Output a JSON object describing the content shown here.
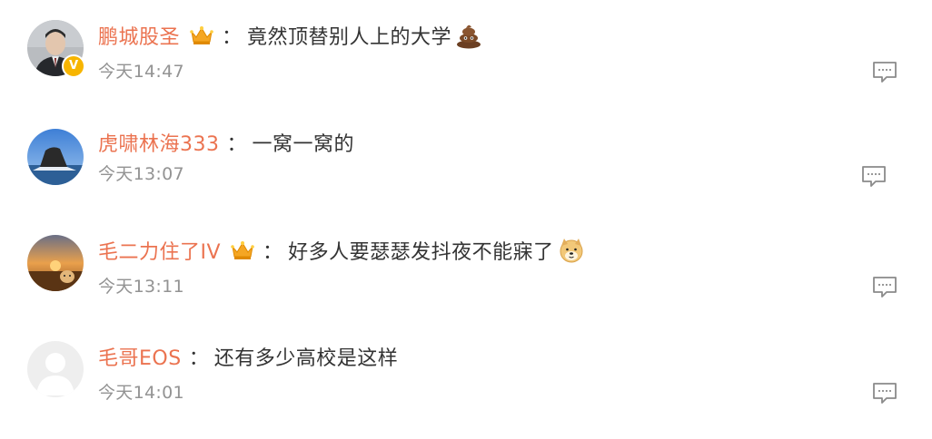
{
  "comments": [
    {
      "username": "鹏城股圣",
      "has_crown": true,
      "verified": true,
      "separator": "：",
      "text": "竟然顶替别人上的大学",
      "emoji": "poop-emoji",
      "timestamp": "今天14:47",
      "avatar": "avatar-man-suit"
    },
    {
      "username": "虎啸林海333",
      "has_crown": false,
      "verified": false,
      "separator": "：",
      "text": "一窝一窝的",
      "emoji": "",
      "timestamp": "今天13:07",
      "avatar": "avatar-rock-sea"
    },
    {
      "username": "毛二力住了IV",
      "has_crown": true,
      "verified": false,
      "separator": "：",
      "text": "好多人要瑟瑟发抖夜不能寐了",
      "emoji": "doge-emoji",
      "timestamp": "今天13:11",
      "avatar": "avatar-sunset-dog"
    },
    {
      "username": "毛哥EOS",
      "has_crown": false,
      "verified": false,
      "separator": "：",
      "text": "还有多少高校是这样",
      "emoji": "",
      "timestamp": "今天14:01",
      "avatar": "avatar-default-gray"
    }
  ],
  "badges": {
    "verified_glyph": "V"
  },
  "colors": {
    "username": "#eb7350",
    "text": "#333333",
    "timestamp": "#939393",
    "crown": "#f5a623",
    "verified": "#f7b500",
    "reply_icon": "#8a8a8a"
  },
  "icons": {
    "reply": "reply-comment-icon",
    "crown": "crown-icon"
  }
}
